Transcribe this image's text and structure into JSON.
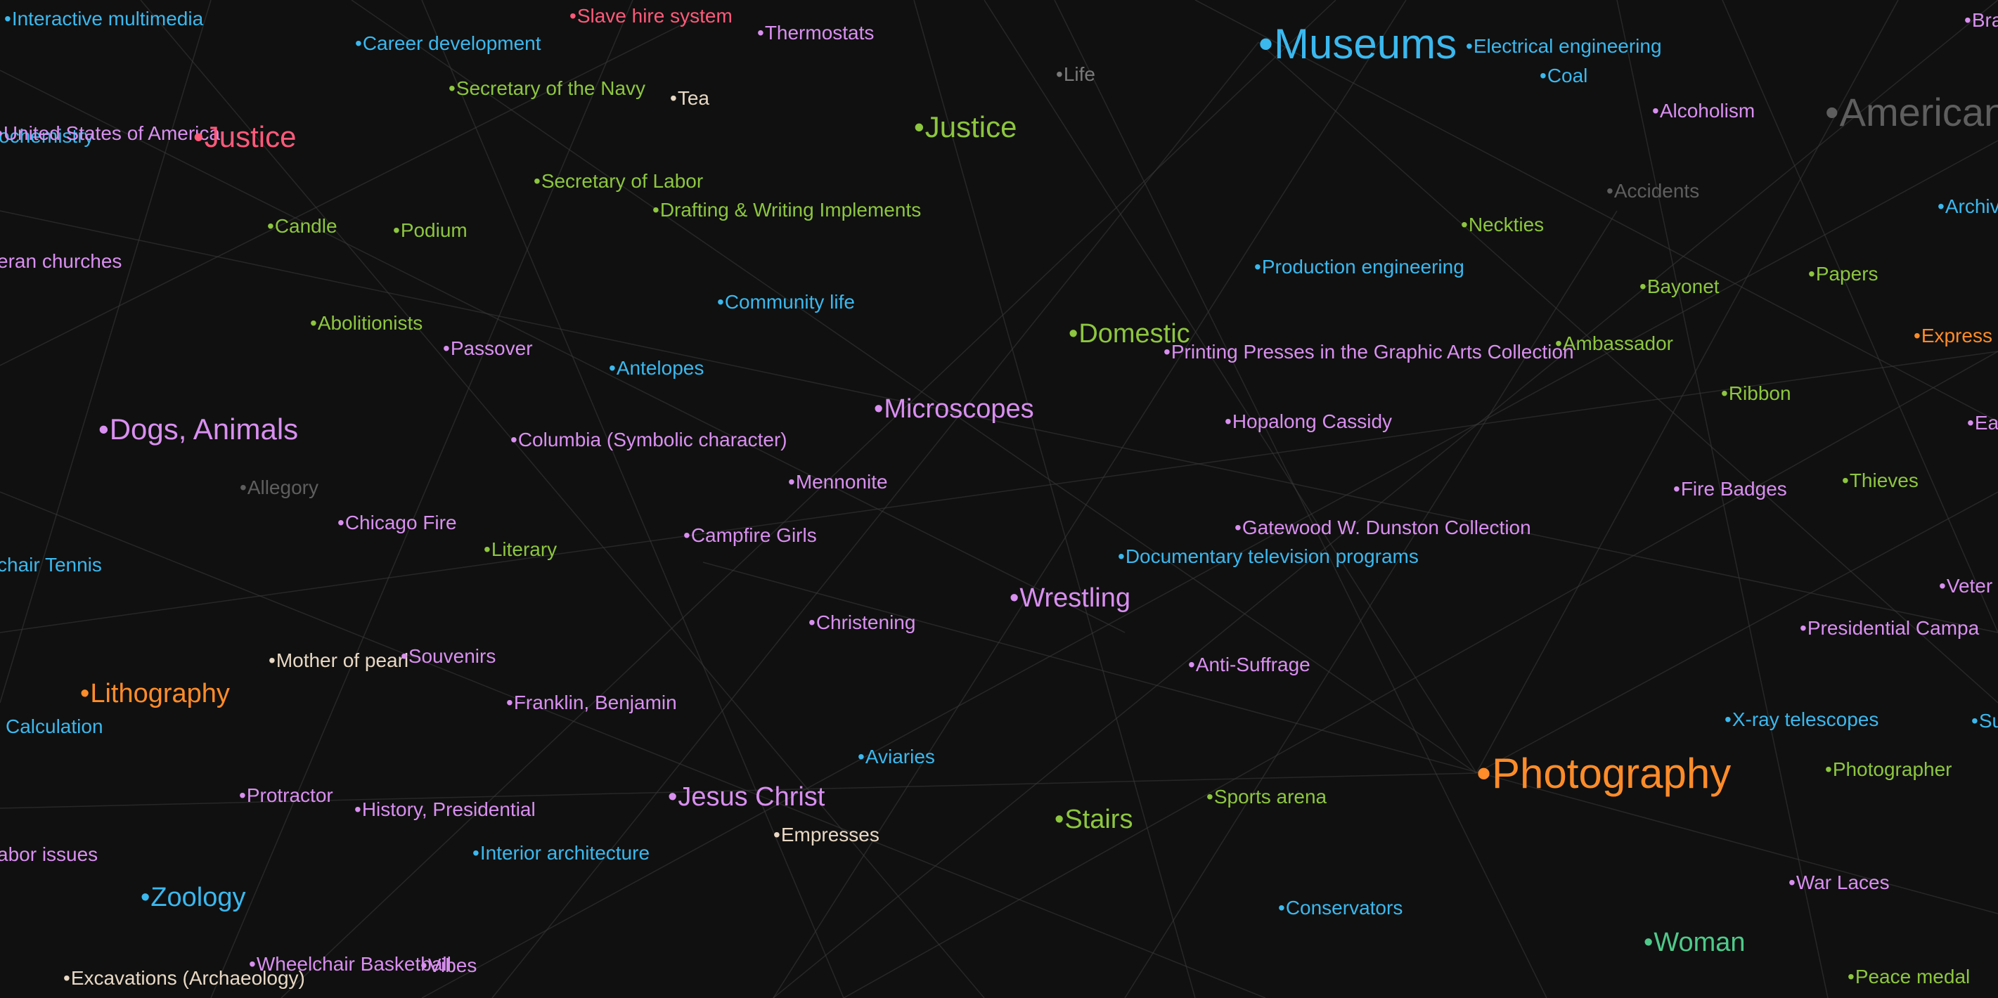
{
  "graph": {
    "nodes": [
      {
        "id": "interactive-multimedia",
        "label": "Interactive multimedia",
        "color": "#3bb8ee"
      },
      {
        "id": "career-development",
        "label": "Career development",
        "color": "#3bb8ee"
      },
      {
        "id": "slave-hire-system",
        "label": "Slave hire system",
        "color": "#ff5a7a"
      },
      {
        "id": "thermostats",
        "label": "Thermostats",
        "color": "#d98ff0"
      },
      {
        "id": "museums",
        "label": "Museums",
        "color": "#3bb8ee"
      },
      {
        "id": "electrical-engineering",
        "label": "Electrical engineering",
        "color": "#3bb8ee"
      },
      {
        "id": "bra",
        "label": "Bra",
        "color": "#d98ff0"
      },
      {
        "id": "life",
        "label": "Life",
        "color": "#7a7a7a"
      },
      {
        "id": "coal",
        "label": "Coal",
        "color": "#3bb8ee"
      },
      {
        "id": "secretary-of-the-navy",
        "label": "Secretary of the Navy",
        "color": "#8dc63f"
      },
      {
        "id": "tea",
        "label": "Tea",
        "color": "#e8d8c4"
      },
      {
        "id": "alcoholism",
        "label": "Alcoholism",
        "color": "#d98ff0"
      },
      {
        "id": "american",
        "label": "American",
        "color": "#5e5e5e"
      },
      {
        "id": "united-states",
        "label": "United States of America",
        "color": "#d98ff0"
      },
      {
        "id": "geochemistry",
        "label": "Geochemistry",
        "color": "#3bb8ee"
      },
      {
        "id": "justice-red",
        "label": "Justice",
        "color": "#ff5a7a"
      },
      {
        "id": "justice-green",
        "label": "Justice",
        "color": "#8dc63f"
      },
      {
        "id": "secretary-of-labor",
        "label": "Secretary of Labor",
        "color": "#8dc63f"
      },
      {
        "id": "accidents",
        "label": "Accidents",
        "color": "#5e5e5e"
      },
      {
        "id": "archives",
        "label": "Archiv",
        "color": "#3bb8ee"
      },
      {
        "id": "drafting",
        "label": "Drafting & Writing Implements",
        "color": "#8dc63f"
      },
      {
        "id": "candle",
        "label": "Candle",
        "color": "#8dc63f"
      },
      {
        "id": "podium",
        "label": "Podium",
        "color": "#8dc63f"
      },
      {
        "id": "neckties",
        "label": "Neckties",
        "color": "#8dc63f"
      },
      {
        "id": "lutheran-churches",
        "label": "eran churches",
        "color": "#d98ff0"
      },
      {
        "id": "production-engineering",
        "label": "Production engineering",
        "color": "#3bb8ee"
      },
      {
        "id": "papers",
        "label": "Papers",
        "color": "#8dc63f"
      },
      {
        "id": "bayonet",
        "label": "Bayonet",
        "color": "#8dc63f"
      },
      {
        "id": "community-life",
        "label": "Community life",
        "color": "#3bb8ee"
      },
      {
        "id": "abolitionists",
        "label": "Abolitionists",
        "color": "#8dc63f"
      },
      {
        "id": "domestic",
        "label": "Domestic",
        "color": "#8dc63f"
      },
      {
        "id": "express",
        "label": "Express",
        "color": "#ff8c2a"
      },
      {
        "id": "passover",
        "label": "Passover",
        "color": "#d98ff0"
      },
      {
        "id": "printing-presses",
        "label": "Printing Presses in the Graphic Arts Collection",
        "color": "#d98ff0"
      },
      {
        "id": "ambassador",
        "label": "Ambassador",
        "color": "#8dc63f"
      },
      {
        "id": "antelopes",
        "label": "Antelopes",
        "color": "#3bb8ee"
      },
      {
        "id": "ribbon",
        "label": "Ribbon",
        "color": "#8dc63f"
      },
      {
        "id": "microscopes",
        "label": "Microscopes",
        "color": "#d98ff0"
      },
      {
        "id": "dogs-animals",
        "label": "Dogs, Animals",
        "color": "#d98ff0"
      },
      {
        "id": "hopalong-cassidy",
        "label": "Hopalong Cassidy",
        "color": "#d98ff0"
      },
      {
        "id": "ea",
        "label": "Ea",
        "color": "#d98ff0"
      },
      {
        "id": "columbia",
        "label": "Columbia (Symbolic character)",
        "color": "#d98ff0"
      },
      {
        "id": "mennonite",
        "label": "Mennonite",
        "color": "#d98ff0"
      },
      {
        "id": "allegory",
        "label": "Allegory",
        "color": "#5e5e5e"
      },
      {
        "id": "fire-badges",
        "label": "Fire Badges",
        "color": "#d98ff0"
      },
      {
        "id": "thieves",
        "label": "Thieves",
        "color": "#8dc63f"
      },
      {
        "id": "chicago-fire",
        "label": "Chicago Fire",
        "color": "#d98ff0"
      },
      {
        "id": "gatewood",
        "label": "Gatewood W. Dunston Collection",
        "color": "#d98ff0"
      },
      {
        "id": "campfire-girls",
        "label": "Campfire Girls",
        "color": "#d98ff0"
      },
      {
        "id": "literary",
        "label": "Literary",
        "color": "#8dc63f"
      },
      {
        "id": "documentary-tv",
        "label": "Documentary television programs",
        "color": "#3bb8ee"
      },
      {
        "id": "wheelchair-tennis",
        "label": "chair Tennis",
        "color": "#3bb8ee"
      },
      {
        "id": "wrestling",
        "label": "Wrestling",
        "color": "#d98ff0"
      },
      {
        "id": "veterans",
        "label": "Veter",
        "color": "#d98ff0"
      },
      {
        "id": "christening",
        "label": "Christening",
        "color": "#d98ff0"
      },
      {
        "id": "presidential-campaign",
        "label": "Presidential Campa",
        "color": "#d98ff0"
      },
      {
        "id": "mother-of-pearl",
        "label": "Mother of pearl",
        "color": "#e8d8c4"
      },
      {
        "id": "souvenirs",
        "label": "Souvenirs",
        "color": "#d98ff0"
      },
      {
        "id": "anti-suffrage",
        "label": "Anti-Suffrage",
        "color": "#d98ff0"
      },
      {
        "id": "lithography",
        "label": "Lithography",
        "color": "#ff8c2a"
      },
      {
        "id": "franklin-benjamin",
        "label": "Franklin, Benjamin",
        "color": "#d98ff0"
      },
      {
        "id": "calculation",
        "label": "Calculation",
        "color": "#3bb8ee"
      },
      {
        "id": "x-ray-telescopes",
        "label": "X-ray telescopes",
        "color": "#3bb8ee"
      },
      {
        "id": "su",
        "label": "Su",
        "color": "#3bb8ee"
      },
      {
        "id": "aviaries",
        "label": "Aviaries",
        "color": "#3bb8ee"
      },
      {
        "id": "photography",
        "label": "Photography",
        "color": "#ff8c2a"
      },
      {
        "id": "photographer",
        "label": "Photographer",
        "color": "#8dc63f"
      },
      {
        "id": "protractor",
        "label": "Protractor",
        "color": "#d98ff0"
      },
      {
        "id": "jesus-christ",
        "label": "Jesus Christ",
        "color": "#d98ff0"
      },
      {
        "id": "sports-arena",
        "label": "Sports arena",
        "color": "#8dc63f"
      },
      {
        "id": "history-presidential",
        "label": "History, Presidential",
        "color": "#d98ff0"
      },
      {
        "id": "stairs",
        "label": "Stairs",
        "color": "#8dc63f"
      },
      {
        "id": "empresses",
        "label": "Empresses",
        "color": "#e8d8c4"
      },
      {
        "id": "labor-issues",
        "label": "abor issues",
        "color": "#d98ff0"
      },
      {
        "id": "interior-architecture",
        "label": "Interior architecture",
        "color": "#3bb8ee"
      },
      {
        "id": "war-laces",
        "label": "War Laces",
        "color": "#d98ff0"
      },
      {
        "id": "zoology",
        "label": "Zoology",
        "color": "#3bb8ee"
      },
      {
        "id": "conservators",
        "label": "Conservators",
        "color": "#3bb8ee"
      },
      {
        "id": "woman",
        "label": "Woman",
        "color": "#4fc98a"
      },
      {
        "id": "wheelchair-basketball",
        "label": "Wheelchair Basketball",
        "color": "#d98ff0"
      },
      {
        "id": "vibes",
        "label": "Vibes",
        "color": "#d98ff0"
      },
      {
        "id": "excavations",
        "label": "Excavations (Archaeology)",
        "color": "#e8d8c4"
      },
      {
        "id": "peace-medal",
        "label": "Peace medal",
        "color": "#8dc63f"
      }
    ]
  }
}
